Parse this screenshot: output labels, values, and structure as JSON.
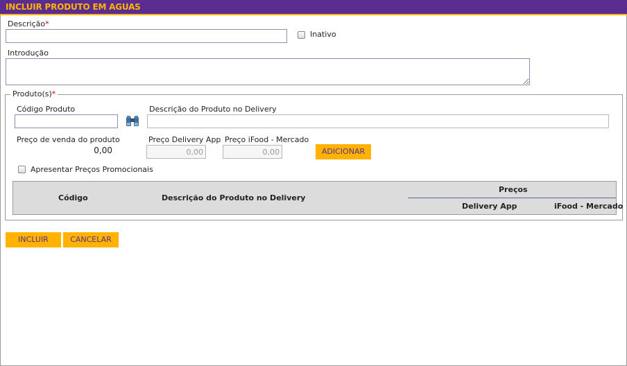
{
  "window": {
    "title": "INCLUIR PRODUTO EM AGUAS"
  },
  "form": {
    "descricao_label": "Descrição",
    "required_mark": "*",
    "descricao_value": "",
    "inativo_label": "Inativo",
    "introducao_label": "Introdução",
    "introducao_value": ""
  },
  "produtos": {
    "legend": "Produto(s)",
    "codigo_label": "Código Produto",
    "codigo_value": "",
    "descricao_delivery_label": "Descrição do Produto no Delivery",
    "descricao_delivery_value": "",
    "preco_venda_label": "Preço de venda do produto",
    "preco_venda_value": "0,00",
    "preco_delivery_label": "Preço Delivery App",
    "preco_delivery_value": "0,00",
    "preco_ifood_label": "Preço iFood - Mercado",
    "preco_ifood_value": "0,00",
    "adicionar_label": "ADICIONAR",
    "promocionais_label": "Apresentar Preços Promocionais"
  },
  "table": {
    "col_codigo": "Código",
    "col_descricao": "Descrição do Produto no Delivery",
    "col_precos": "Preços",
    "col_delivery": "Delivery App",
    "col_ifood": "iFood - Mercado"
  },
  "actions": {
    "incluir": "INCLUIR",
    "cancelar": "CANCELAR"
  },
  "colors": {
    "header_bg": "#5b2c8f",
    "accent": "#ffb300",
    "required": "#cc0000"
  },
  "icons": {
    "search": "binoculars-icon",
    "checkbox": "checkbox-icon"
  }
}
